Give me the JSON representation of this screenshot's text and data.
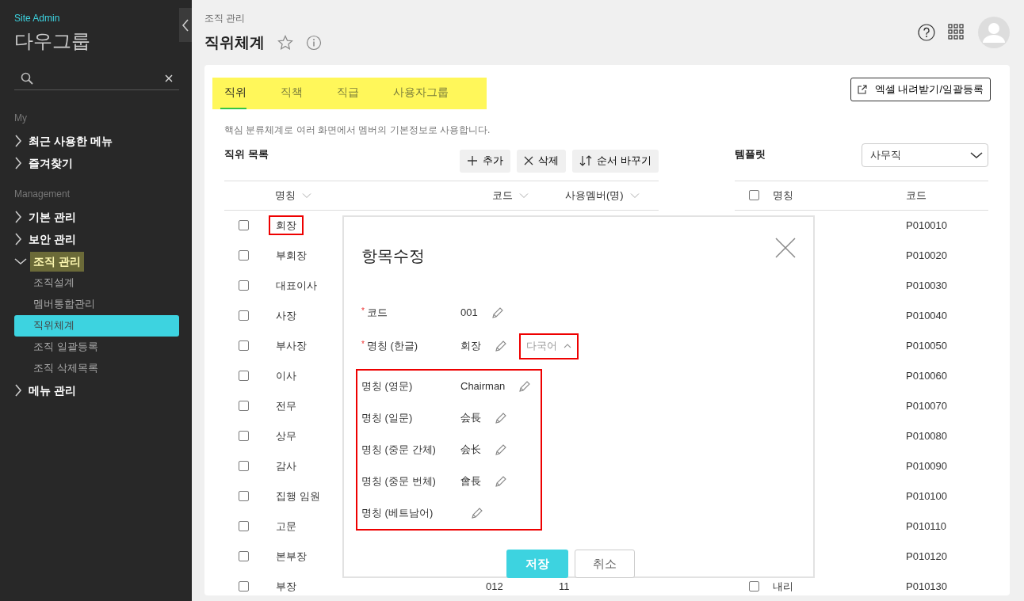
{
  "sidebar": {
    "brand_caption": "Site Admin",
    "brand_title": "다우그룹",
    "sections": [
      {
        "heading": "My",
        "items": [
          {
            "label": "최근 사용한 메뉴",
            "expanded": false,
            "highlighted": false
          },
          {
            "label": "즐겨찾기",
            "expanded": false,
            "highlighted": false
          }
        ]
      },
      {
        "heading": "Management",
        "items": [
          {
            "label": "기본 관리",
            "expanded": false,
            "highlighted": false
          },
          {
            "label": "보안 관리",
            "expanded": false,
            "highlighted": false
          },
          {
            "label": "조직 관리",
            "expanded": true,
            "highlighted": true,
            "children": [
              {
                "label": "조직설계",
                "selected": false
              },
              {
                "label": "멤버통합관리",
                "selected": false
              },
              {
                "label": "직위체계",
                "selected": true
              },
              {
                "label": "조직 일괄등록",
                "selected": false
              },
              {
                "label": "조직 삭제목록",
                "selected": false
              }
            ]
          },
          {
            "label": "메뉴 관리",
            "expanded": false,
            "highlighted": false
          }
        ]
      }
    ]
  },
  "header": {
    "breadcrumb": "조직 관리",
    "title": "직위체계",
    "favorite": false
  },
  "tabs": {
    "highlighted": true,
    "items": [
      {
        "label": "직위",
        "selected": true
      },
      {
        "label": "직책",
        "selected": false
      },
      {
        "label": "직급",
        "selected": false
      },
      {
        "label": "사용자그룹",
        "selected": false
      }
    ]
  },
  "excel_button": "엑셀 내려받기/일괄등록",
  "description": "핵심 분류체계로 여러 화면에서 멤버의 기본정보로 사용합니다.",
  "position_list": {
    "title": "직위 목록",
    "buttons": [
      {
        "label": "추가",
        "kind": "add"
      },
      {
        "label": "삭제",
        "kind": "delete"
      },
      {
        "label": "순서 바꾸기",
        "kind": "reorder"
      }
    ],
    "columns": [
      "명칭",
      "코드",
      "사용멤버(명)"
    ],
    "rows": [
      {
        "checked": false,
        "name": "회장",
        "highlighted": true
      },
      {
        "checked": false,
        "name": "부회장",
        "highlighted": false
      },
      {
        "checked": false,
        "name": "대표이사",
        "highlighted": false
      },
      {
        "checked": false,
        "name": "사장",
        "highlighted": false
      },
      {
        "checked": false,
        "name": "부사장",
        "highlighted": false
      },
      {
        "checked": false,
        "name": "이사",
        "highlighted": false
      },
      {
        "checked": false,
        "name": "전무",
        "highlighted": false
      },
      {
        "checked": false,
        "name": "상무",
        "highlighted": false
      },
      {
        "checked": false,
        "name": "감사",
        "highlighted": false
      },
      {
        "checked": false,
        "name": "집행 임원",
        "highlighted": false
      },
      {
        "checked": false,
        "name": "고문",
        "highlighted": false
      },
      {
        "checked": false,
        "name": "본부장",
        "highlighted": false
      },
      {
        "checked": false,
        "name": "부장",
        "highlighted": false,
        "code": "012",
        "members": "11"
      }
    ]
  },
  "template": {
    "title": "템플릿",
    "select_value": "사무직",
    "header_checked": false,
    "columns": [
      "명칭",
      "코드"
    ],
    "rows": [
      {
        "code": "P010010"
      },
      {
        "code": "P010020"
      },
      {
        "code": "P010030"
      },
      {
        "code": "P010040"
      },
      {
        "code": "P010050"
      },
      {
        "code": "P010060"
      },
      {
        "code": "P010070"
      },
      {
        "code": "P010080"
      },
      {
        "code": "P010090"
      },
      {
        "code": "P010100"
      },
      {
        "code": "P010110"
      },
      {
        "code": "P010120"
      },
      {
        "checked": false,
        "name": "내리",
        "code": "P010130"
      }
    ]
  },
  "modal": {
    "title": "항목수정",
    "fields": [
      {
        "label": "코드",
        "required_mark": "*",
        "value": "001"
      },
      {
        "label": "명칭 (한글)",
        "required_mark": "*",
        "value": "회장",
        "multilang_toggle": {
          "label": "다국어",
          "expanded": true,
          "highlighted": true
        }
      }
    ],
    "multilang": {
      "highlighted": true,
      "fields": [
        {
          "label": "명칭 (영문)",
          "value": "Chairman"
        },
        {
          "label": "명칭 (일문)",
          "value": "会長"
        },
        {
          "label": "명칭 (중문 간체)",
          "value": "会长"
        },
        {
          "label": "명칭 (중문 번체)",
          "value": "會長"
        },
        {
          "label": "명칭 (베트남어)"
        }
      ]
    },
    "buttons": [
      {
        "label": "저장",
        "kind": "primary"
      },
      {
        "label": "취소",
        "kind": "secondary"
      }
    ]
  }
}
